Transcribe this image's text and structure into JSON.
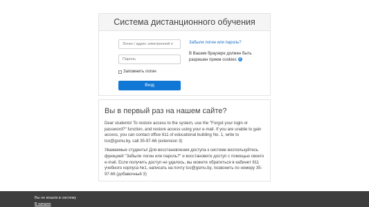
{
  "login": {
    "title": "Система дистанционного обучения",
    "username_placeholder": "Логин / адрес электронной п",
    "password_placeholder": "Пароль",
    "remember_label": "Запомнить логин",
    "login_button": "Вход",
    "forgot_link": "Забыли логин или пароль?",
    "cookie_note": "В Вашем браузере должен быть разрешен прием cookies"
  },
  "first_time": {
    "title": "Вы в первый раз на нашем сайте?",
    "text_en": "Dear students! To restore access to the system, use the \"Forgot your login or password?\" function, and restore access using your e-mail. If you are unable to gain access, you can contact office 611 of educational building No. 1, write to tco@gsmu.by, call 35-97-66 (extension 3)",
    "text_ru": "Уважаемые студенты! Для восстановления доступа к системе воспользуйтесь функцией \"Забыли логин или пароль?\" и восстановите доступ с помощью своего e-mail. Если получить доступ не удалось, вы можете обратиться в кабинет 611 учебного корпуса №1, написать на почту tco@gsmu.by, позвонить по номеру 35-97-66 (добавочный 3)"
  },
  "footer": {
    "status": "Вы не вошли в систему",
    "home_link": "В начало"
  },
  "icons": {
    "help": "question-circle-icon"
  },
  "colors": {
    "primary_button": "#1077d4",
    "link": "#1a6fc4",
    "footer_bg": "#3d3d3d"
  }
}
